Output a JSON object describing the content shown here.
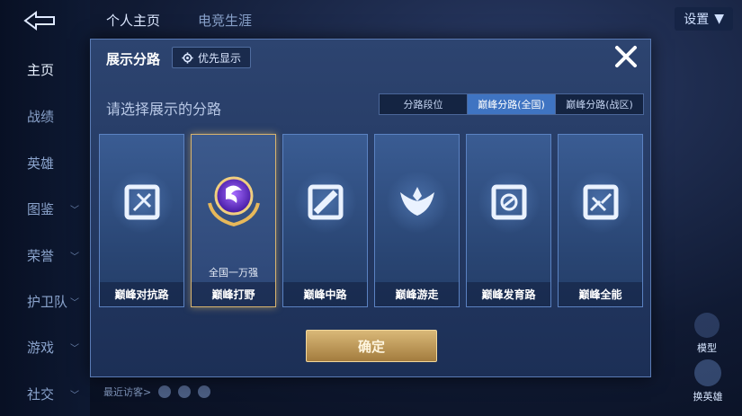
{
  "nav": {
    "items": [
      {
        "label": "主页",
        "active": true,
        "chevron": false
      },
      {
        "label": "战绩",
        "active": false,
        "chevron": false
      },
      {
        "label": "英雄",
        "active": false,
        "chevron": false
      },
      {
        "label": "图鉴",
        "active": false,
        "chevron": true
      },
      {
        "label": "荣誉",
        "active": false,
        "chevron": true
      },
      {
        "label": "护卫队",
        "active": false,
        "chevron": true
      },
      {
        "label": "游戏",
        "active": false,
        "chevron": true
      },
      {
        "label": "社交",
        "active": false,
        "chevron": true
      }
    ]
  },
  "top_tabs": [
    "个人主页",
    "电竞生涯"
  ],
  "settings_label": "设置",
  "right_actions": {
    "model": "模型",
    "swap_hero": "换英雄"
  },
  "bottom": {
    "visitors": "最近访客>"
  },
  "dialog": {
    "title": "展示分路",
    "priority_button": "优先显示",
    "subtitle": "请选择展示的分路",
    "tabs": [
      {
        "label": "分路段位",
        "active": false
      },
      {
        "label": "巅峰分路(全国)",
        "active": true
      },
      {
        "label": "巅峰分路(战区)",
        "active": false
      }
    ],
    "cards": [
      {
        "label": "巅峰对抗路",
        "icon": "sword-shield-icon",
        "selected": false,
        "rank": ""
      },
      {
        "label": "巅峰打野",
        "icon": "jungle-crest-icon",
        "selected": true,
        "rank": "全国一万强"
      },
      {
        "label": "巅峰中路",
        "icon": "mid-lane-icon",
        "selected": false,
        "rank": ""
      },
      {
        "label": "巅峰游走",
        "icon": "wings-icon",
        "selected": false,
        "rank": ""
      },
      {
        "label": "巅峰发育路",
        "icon": "target-icon",
        "selected": false,
        "rank": ""
      },
      {
        "label": "巅峰全能",
        "icon": "all-round-icon",
        "selected": false,
        "rank": ""
      }
    ],
    "confirm_label": "确定"
  },
  "colors": {
    "accent_blue": "#3f74c2",
    "gold": "#d8b46e",
    "panel": "#2d4470"
  }
}
